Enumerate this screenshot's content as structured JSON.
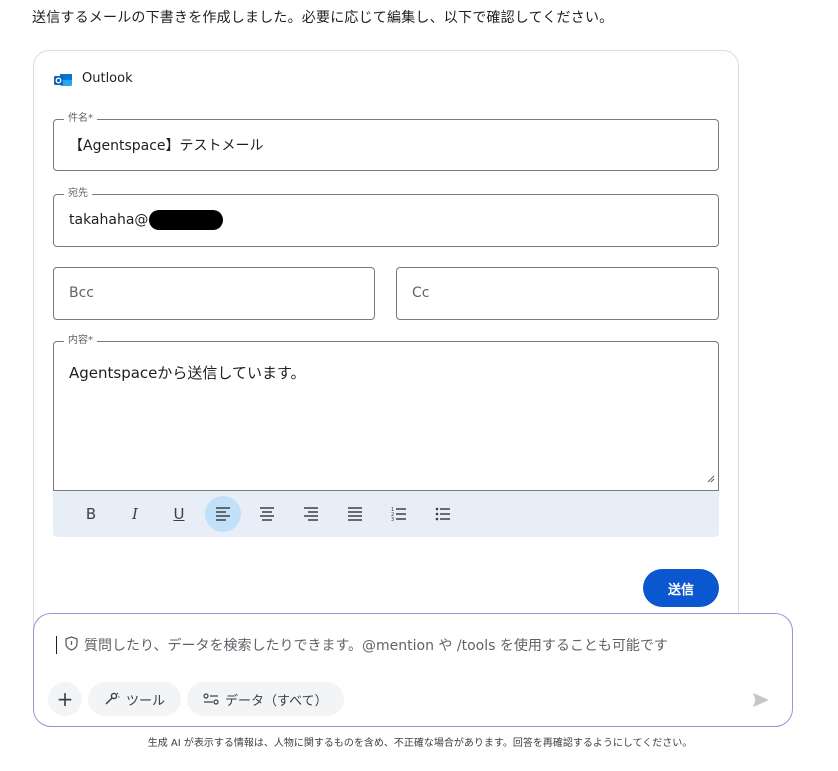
{
  "intro_text": "送信するメールの下書きを作成しました。必要に応じて編集し、以下で確認してください。",
  "card": {
    "app_name": "Outlook",
    "subject": {
      "label": "件名*",
      "value": "【Agentspace】テストメール"
    },
    "to": {
      "label": "宛先",
      "value": "takahaha@"
    },
    "bcc": {
      "placeholder": "Bcc"
    },
    "cc": {
      "placeholder": "Cc"
    },
    "body": {
      "label": "内容*",
      "value": "Agentspaceから送信しています。"
    },
    "toolbar": {
      "bold": "B",
      "italic": "I",
      "underline": "U",
      "active_alignment": "align-left"
    },
    "send_label": "送信"
  },
  "prompt": {
    "placeholder": "質問したり、データを検索したりできます。@mention や /tools を使用することも可能です",
    "tools_label": "ツール",
    "data_label": "データ（すべて）"
  },
  "disclaimer": "生成 AI が表示する情報は、人物に関するものを含め、不正確な場合があります。回答を再確認するようにしてください。",
  "colors": {
    "accent": "#0b57d0",
    "toolbar_bg": "#e8eef7",
    "prompt_border": "#a78bd6"
  }
}
